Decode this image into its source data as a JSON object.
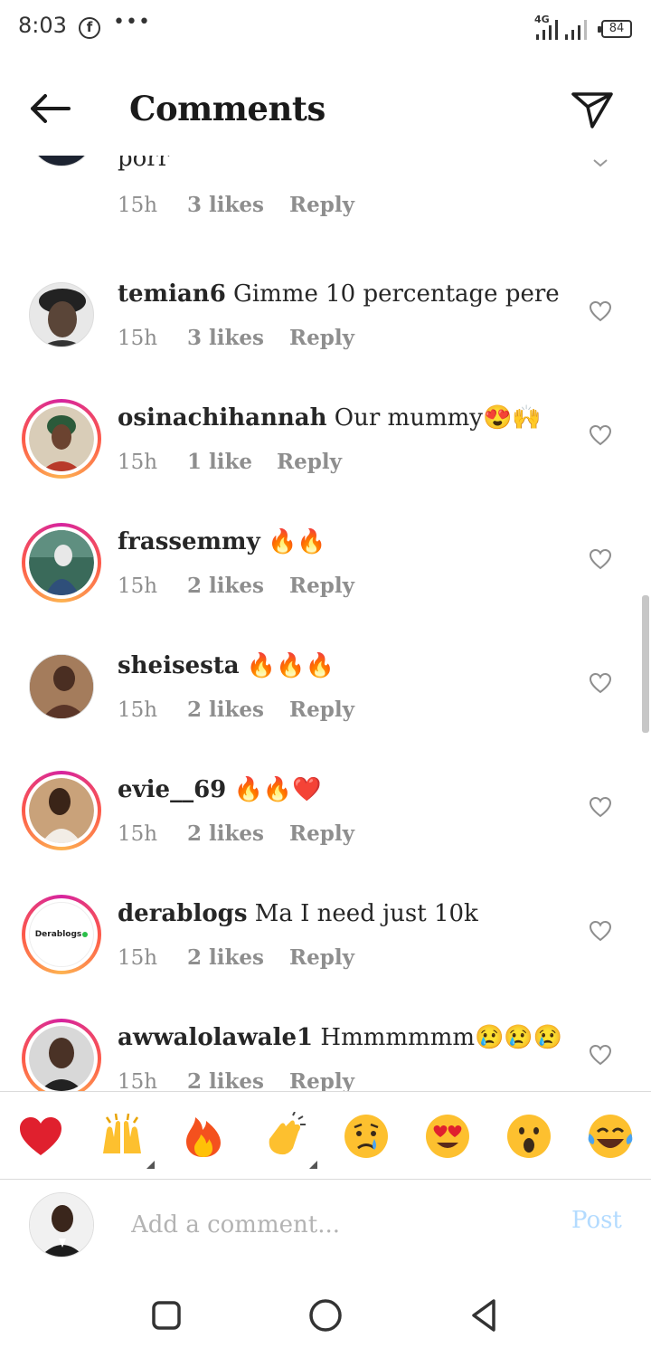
{
  "status_bar": {
    "time": "8:03",
    "network": "4G",
    "battery": "84"
  },
  "header": {
    "title": "Comments"
  },
  "colors": {
    "story_ring_start": "#d6249f",
    "story_ring_end": "#fdb351",
    "meta_text": "#8e8e8e",
    "post_disabled": "#b3dbff"
  },
  "comments": [
    {
      "username": "",
      "text": "porr",
      "time": "15h",
      "likes": "3 likes",
      "reply": "Reply",
      "ring": false
    },
    {
      "username": "temian6",
      "text": "Gimme 10 percentage pere",
      "time": "15h",
      "likes": "3 likes",
      "reply": "Reply",
      "ring": false
    },
    {
      "username": "osinachihannah",
      "text": "Our mummy😍🙌",
      "time": "15h",
      "likes": "1 like",
      "reply": "Reply",
      "ring": true
    },
    {
      "username": "frassemmy",
      "text": "🔥🔥",
      "time": "15h",
      "likes": "2 likes",
      "reply": "Reply",
      "ring": true
    },
    {
      "username": "sheisesta",
      "text": "🔥🔥🔥",
      "time": "15h",
      "likes": "2 likes",
      "reply": "Reply",
      "ring": false
    },
    {
      "username": "evie__69",
      "text": "🔥🔥❤️",
      "time": "15h",
      "likes": "2 likes",
      "reply": "Reply",
      "ring": true
    },
    {
      "username": "derablogs",
      "text": "Ma I need just 10k",
      "time": "15h",
      "likes": "2 likes",
      "reply": "Reply",
      "ring": true,
      "avatar_text": "Derablogs"
    },
    {
      "username": "awwalolawale1",
      "text": "Hmmmmmm😢😢😢",
      "time": "15h",
      "likes": "2 likes",
      "reply": "Reply",
      "ring": true
    }
  ],
  "reactions": [
    "heart-red",
    "raising-hands",
    "fire",
    "clapping-hands",
    "crying-face",
    "heart-eyes",
    "surprised-face",
    "tears-of-joy"
  ],
  "compose": {
    "placeholder": "Add a comment...",
    "post_label": "Post"
  }
}
